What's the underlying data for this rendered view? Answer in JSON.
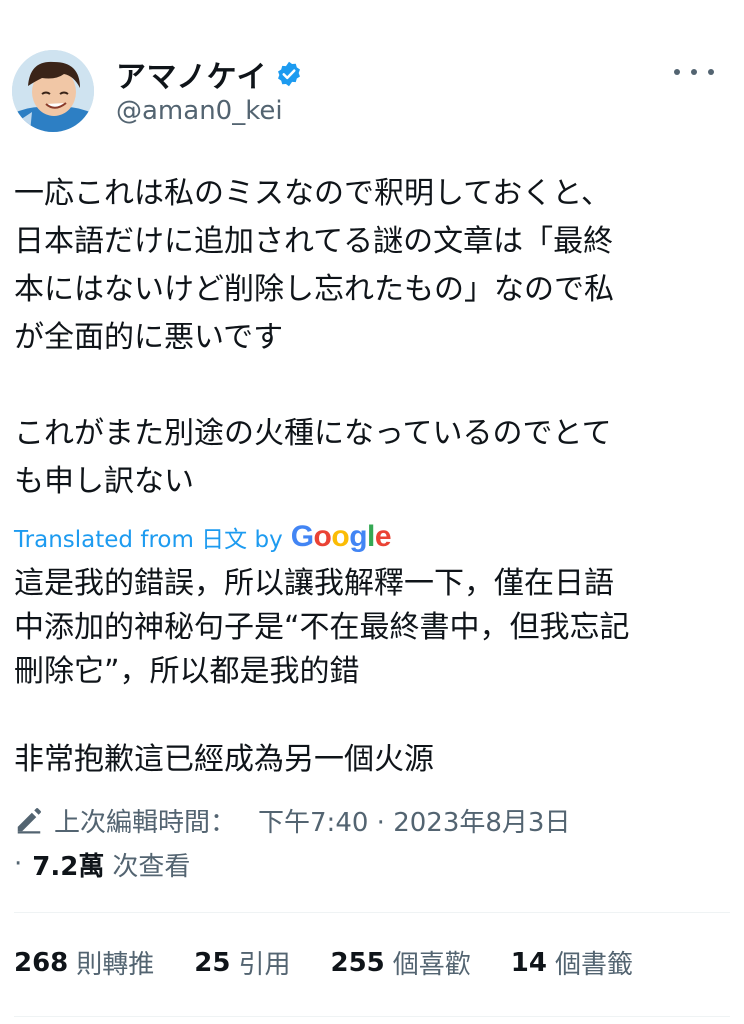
{
  "user": {
    "display_name": "アマノケイ",
    "handle": "@aman0_kei",
    "verified_icon": "verified-badge-icon",
    "verified_color": "#1d9bf0"
  },
  "tweet": {
    "paragraph1": "一応これは私のミスなので釈明しておくと、\n日本語だけに追加されてる謎の文章は「最終\n本にはないけど削除し忘れたもの」なので私\nが全面的に悪いです",
    "paragraph2": "これがまた別途の火種になっているのでとて\nも申し訳ない"
  },
  "translation": {
    "label": "Translated from 日文 by",
    "provider": "Google",
    "paragraph1": "這是我的錯誤，所以讓我解釋一下，僅在日語\n中添加的神秘句子是“不在最終書中，但我忘記\n刪除它”，所以都是我的錯",
    "paragraph2": "非常抱歉這已經成為另一個火源"
  },
  "meta": {
    "edit_label": "上次編輯時間：",
    "timestamp": "下午7:40 · 2023年8月3日",
    "views_prefix": "·",
    "views_count": "7.2萬",
    "views_label": "次查看"
  },
  "stats": [
    {
      "count": "268",
      "label": "則轉推"
    },
    {
      "count": "25",
      "label": "引用"
    },
    {
      "count": "255",
      "label": "個喜歡"
    },
    {
      "count": "14",
      "label": "個書籤"
    }
  ],
  "colors": {
    "accent": "#1d9bf0",
    "secondary_text": "#536471",
    "primary_text": "#0f1419"
  }
}
